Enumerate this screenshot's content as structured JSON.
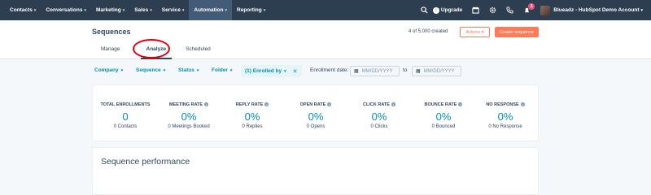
{
  "nav": {
    "items": [
      {
        "label": "Contacts"
      },
      {
        "label": "Conversations"
      },
      {
        "label": "Marketing"
      },
      {
        "label": "Sales"
      },
      {
        "label": "Service"
      },
      {
        "label": "Automation"
      },
      {
        "label": "Reporting"
      }
    ],
    "upgrade_label": "Upgrade",
    "notification_count": "1",
    "account_label": "Blueadz - HubSpot Demo Account"
  },
  "header": {
    "title": "Sequences",
    "created_text": "4 of 5,000 created",
    "actions_label": "Actions",
    "create_label": "Create sequence",
    "tabs": [
      {
        "label": "Manage"
      },
      {
        "label": "Analyze"
      },
      {
        "label": "Scheduled"
      }
    ]
  },
  "filters": {
    "company": "Company",
    "sequence": "Sequence",
    "status": "Status",
    "folder": "Folder",
    "enrolled_by": "(1) Enrolled by",
    "enrollment_date_label": "Enrollment date:",
    "date_placeholder": "MM/DD/YYYY",
    "to_label": "to"
  },
  "stats": [
    {
      "label": "TOTAL ENROLLMENTS",
      "value": "0",
      "sub": "0 Contacts",
      "info": false
    },
    {
      "label": "MEETING RATE",
      "value": "0%",
      "sub": "0 Meetings Booked",
      "info": true
    },
    {
      "label": "REPLY RATE",
      "value": "0%",
      "sub": "0 Replies",
      "info": true
    },
    {
      "label": "OPEN RATE",
      "value": "0%",
      "sub": "0 Opens",
      "info": true
    },
    {
      "label": "CLICK RATE",
      "value": "0%",
      "sub": "0 Clicks",
      "info": true
    },
    {
      "label": "BOUNCE RATE",
      "value": "0%",
      "sub": "0 Bounced",
      "info": true
    },
    {
      "label": "NO RESPONSE",
      "value": "0%",
      "sub": "0 No Response",
      "info": true
    }
  ],
  "performance": {
    "title": "Sequence performance"
  },
  "colors": {
    "nav_bg": "#2d3e50",
    "accent_orange": "#ff7a59",
    "link_teal": "#0091ae",
    "highlight_circle": "#e0000b"
  }
}
